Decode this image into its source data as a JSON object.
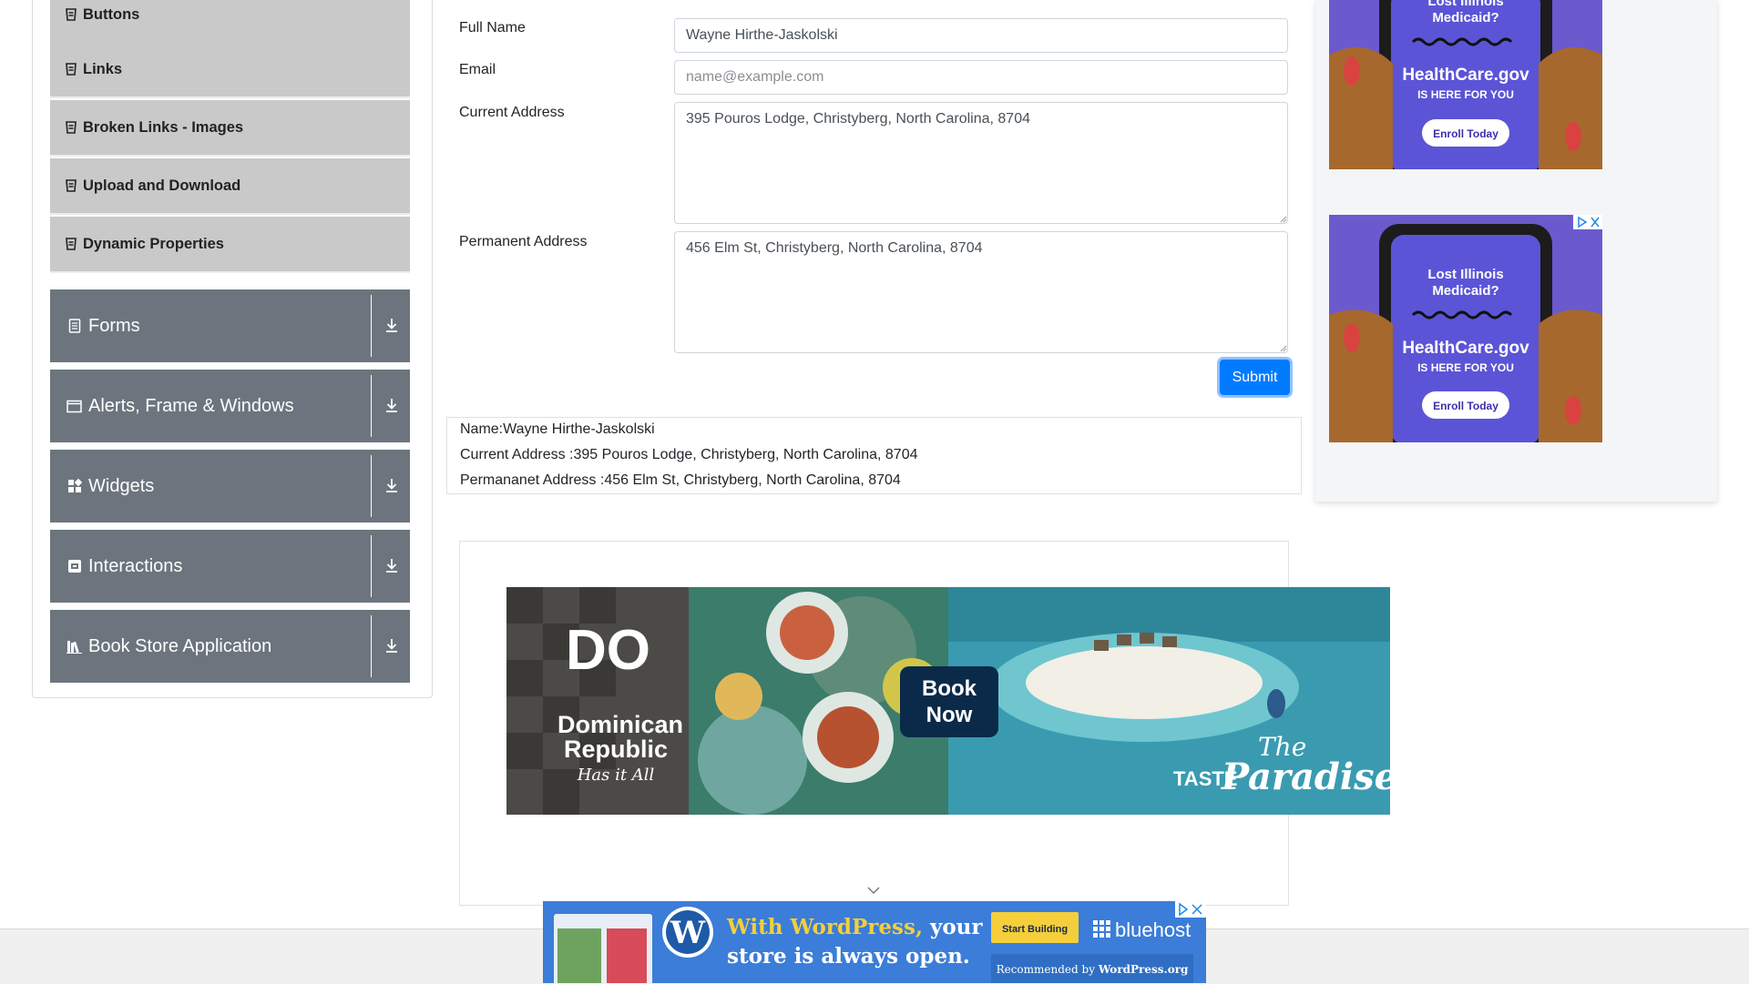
{
  "sidebar": {
    "sub_items": [
      "Buttons",
      "Links",
      "Broken Links - Images",
      "Upload and Download",
      "Dynamic Properties"
    ],
    "groups": [
      "Forms",
      "Alerts, Frame & Windows",
      "Widgets",
      "Interactions",
      "Book Store Application"
    ]
  },
  "form": {
    "full_name_label": "Full Name",
    "full_name_value": "Wayne Hirthe-Jaskolski",
    "email_label": "Email",
    "email_placeholder": "name@example.com",
    "current_address_label": "Current Address",
    "current_address_value": "395 Pouros Lodge, Christyberg, North Carolina, 8704",
    "permanent_address_label": "Permanent Address",
    "permanent_address_value": "456 Elm St, Christyberg, North Carolina, 8704",
    "submit_label": "Submit"
  },
  "output": {
    "name_line": "Name:Wayne Hirthe-Jaskolski",
    "current_line": "Current Address :395 Pouros Lodge, Christyberg, North Carolina, 8704",
    "permanent_line": "Permananet Address :456 Elm St, Christyberg, North Carolina, 8704"
  },
  "ads": {
    "healthcare_top": {
      "headline": "Lost Illinois Medicaid?",
      "brand": "HealthCare.gov",
      "tagline": "IS HERE FOR YOU",
      "cta": "Enroll Today"
    },
    "healthcare_bottom": {
      "headline": "Lost Illinois Medicaid?",
      "brand": "HealthCare.gov",
      "tagline": "IS HERE FOR YOU",
      "cta": "Enroll Today"
    },
    "dominican": {
      "logo": "Dominican Republic",
      "motto": "Has it All",
      "cta": "Book Now",
      "taste": "TASTE",
      "paradise": "The Paradise"
    },
    "wordpress": {
      "headline_a": "With WordPress,",
      "headline_b": " your",
      "headline_c": "store is always open.",
      "cta": "Start Building",
      "brand": "bluehost",
      "recommended": "Recommended by ",
      "recommended_brand": "WordPress.org"
    }
  },
  "colors": {
    "nav_group_bg": "#6c757d",
    "nav_item_bg": "#c9c9c9",
    "primary": "#007bff",
    "ad_purple": "#6a5acd",
    "ad_blue": "#3b7dd8"
  }
}
